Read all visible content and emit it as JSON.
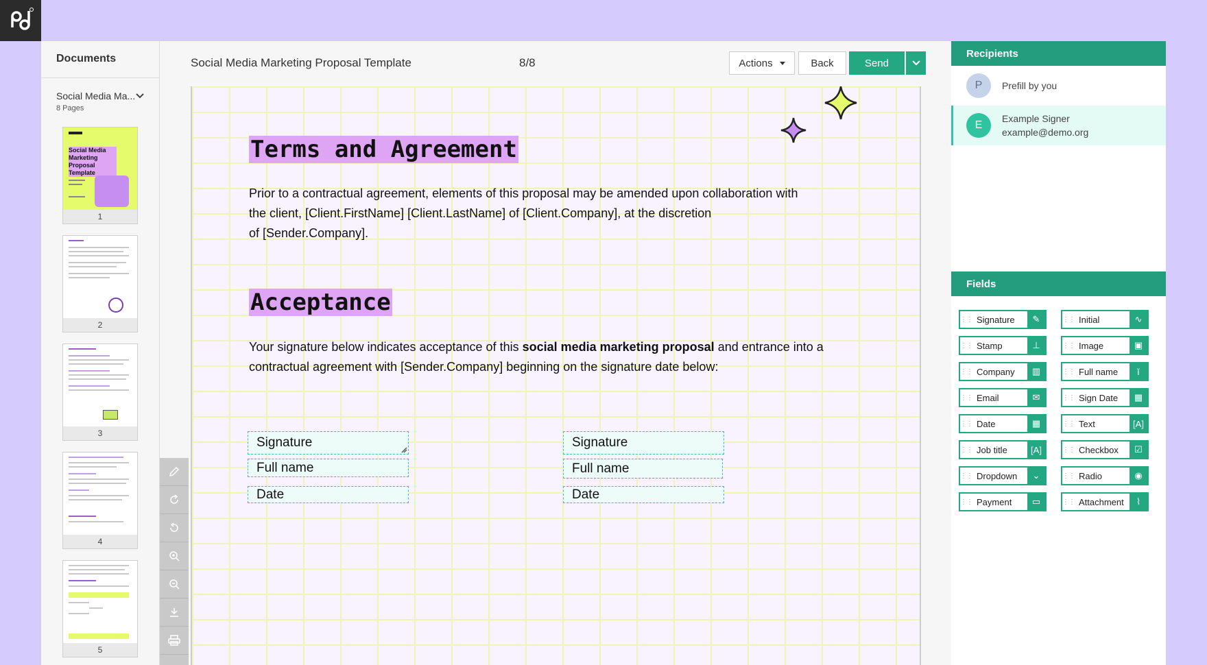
{
  "documents": {
    "header": "Documents",
    "selected_doc": "Social Media Ma...",
    "page_count_label": "8 Pages",
    "thumbnails": [
      {
        "num": "1",
        "title": "Social Media Marketing Proposal Template"
      },
      {
        "num": "2"
      },
      {
        "num": "3"
      },
      {
        "num": "4"
      },
      {
        "num": "5"
      }
    ]
  },
  "toolbar": {
    "title": "Social Media Marketing Proposal Template",
    "page_indicator": "8/8",
    "actions_label": "Actions",
    "back_label": "Back",
    "send_label": "Send"
  },
  "tools": [
    "pencil-icon",
    "redo-icon",
    "undo-icon",
    "zoom-in-icon",
    "zoom-out-icon",
    "download-icon",
    "print-icon"
  ],
  "document": {
    "heading1": "Terms and Agreement",
    "para1_line1": "Prior to a contractual agreement, elements of this proposal may be amended upon collaboration with",
    "para1_line2": "the client, [Client.FirstName] [Client.LastName] of [Client.Company], at the discretion",
    "para1_line3": "of [Sender.Company].",
    "heading2": "Acceptance",
    "para2_pre": "Your signature below indicates acceptance of this ",
    "para2_bold": "social media marketing proposal",
    "para2_post": " and entrance into a",
    "para2_line2": "contractual agreement with [Sender.Company] beginning on the signature date below:",
    "left_fields": {
      "signature": "Signature",
      "full_name": "Full name",
      "date": "Date"
    },
    "right_fields": {
      "signature": "Signature",
      "full_name": "Full name",
      "date": "Date"
    }
  },
  "recipients": {
    "header": "Recipients",
    "list": [
      {
        "initial": "P",
        "name": "Prefill by you",
        "email": "",
        "color": "#c5d3ea"
      },
      {
        "initial": "E",
        "name": "Example Signer",
        "email": "example@demo.org",
        "color": "#2fc3a0"
      }
    ]
  },
  "fields": {
    "header": "Fields",
    "items": [
      {
        "label": "Signature",
        "icon": "signature-icon"
      },
      {
        "label": "Initial",
        "icon": "initial-icon"
      },
      {
        "label": "Stamp",
        "icon": "stamp-icon"
      },
      {
        "label": "Image",
        "icon": "image-icon"
      },
      {
        "label": "Company",
        "icon": "company-icon"
      },
      {
        "label": "Full name",
        "icon": "person-icon"
      },
      {
        "label": "Email",
        "icon": "email-icon"
      },
      {
        "label": "Sign Date",
        "icon": "calendar-icon"
      },
      {
        "label": "Date",
        "icon": "calendar-icon"
      },
      {
        "label": "Text",
        "icon": "text-icon"
      },
      {
        "label": "Job title",
        "icon": "text-icon"
      },
      {
        "label": "Checkbox",
        "icon": "checkbox-icon"
      },
      {
        "label": "Dropdown",
        "icon": "dropdown-icon"
      },
      {
        "label": "Radio",
        "icon": "radio-icon"
      },
      {
        "label": "Payment",
        "icon": "wallet-icon"
      },
      {
        "label": "Attachment",
        "icon": "paperclip-icon"
      }
    ]
  },
  "colors": {
    "accent": "#24a882",
    "background": "#d5ccfd",
    "highlight": "#dda5f4"
  }
}
